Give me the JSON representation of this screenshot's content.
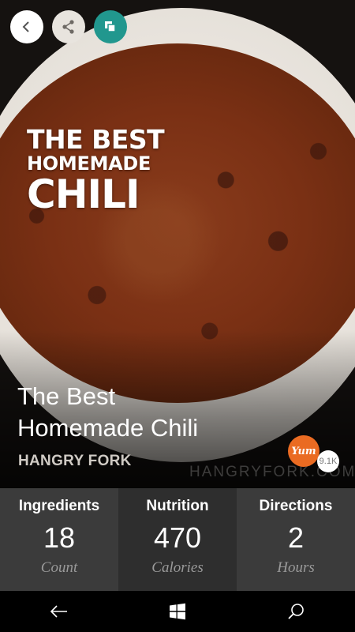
{
  "hero": {
    "overlay_line1": "THE BEST",
    "overlay_line2": "HOMEMADE",
    "overlay_line3": "CHILI",
    "watermark": "HANGRYFORK.COM"
  },
  "top_buttons": {
    "back_icon": "chevron-left-icon",
    "share_icon": "share-icon",
    "copy_icon": "copy-icon",
    "accent_color": "#21978e"
  },
  "recipe": {
    "title_line1": "The Best",
    "title_line2": "Homemade Chili",
    "source": "HANGRY FORK"
  },
  "yum": {
    "label": "Yum",
    "count": "9.1K",
    "color": "#ea6b22"
  },
  "stats": [
    {
      "label": "Ingredients",
      "value": "18",
      "unit": "Count"
    },
    {
      "label": "Nutrition",
      "value": "470",
      "unit": "Calories"
    },
    {
      "label": "Directions",
      "value": "2",
      "unit": "Hours"
    }
  ],
  "navbar": {
    "back_icon": "back-arrow-icon",
    "home_icon": "windows-logo-icon",
    "search_icon": "search-icon"
  }
}
